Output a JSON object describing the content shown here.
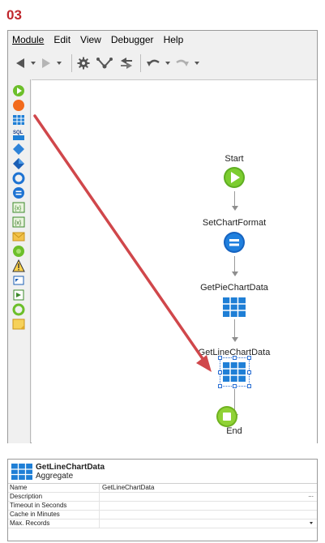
{
  "step_label": "03",
  "menu": {
    "module": "Module",
    "edit": "Edit",
    "view": "View",
    "debugger": "Debugger",
    "help": "Help"
  },
  "toolbar_icons": [
    "back-arrow-icon",
    "forward-arrow-icon",
    "gear-icon",
    "branch-icon",
    "swap-icon",
    "undo-icon",
    "redo-icon"
  ],
  "palette_icons": [
    "start-icon",
    "end-icon",
    "aggregate-icon",
    "sql-icon",
    "if-icon",
    "switch-icon",
    "for-each-icon",
    "assign-icon",
    "json-serialize-icon",
    "json-deserialize-icon",
    "send-email-icon",
    "run-server-action-icon",
    "raise-exception-icon",
    "download-icon",
    "record-list-icon",
    "exception-handler-icon",
    "comment-icon"
  ],
  "flow": {
    "nodes": [
      {
        "label": "Start",
        "icon": "start-icon"
      },
      {
        "label": "SetChartFormat",
        "icon": "assign-icon"
      },
      {
        "label": "GetPieChartData",
        "icon": "aggregate-icon"
      },
      {
        "label": "GetLineChartData",
        "icon": "aggregate-icon"
      },
      {
        "label": "End",
        "icon": "end-icon"
      }
    ]
  },
  "properties": {
    "title": "GetLineChartData",
    "subtitle": "Aggregate",
    "rows": [
      {
        "key": "Name",
        "value": "GetLineChartData"
      },
      {
        "key": "Description",
        "value": ""
      },
      {
        "key": "Timeout in Seconds",
        "value": ""
      },
      {
        "key": "Cache in Minutes",
        "value": ""
      },
      {
        "key": "Max. Records",
        "value": ""
      }
    ],
    "description_ellipsis": "..."
  },
  "colors": {
    "step_label": "#c0272d",
    "arrow_annotation": "#d0474b",
    "start_green": "#6cbf2a",
    "end_green": "#8ccd2e",
    "assign_blue": "#1e73d2",
    "aggregate_blue": "#1f7fd6",
    "selection_blue": "#2a6fd3"
  }
}
